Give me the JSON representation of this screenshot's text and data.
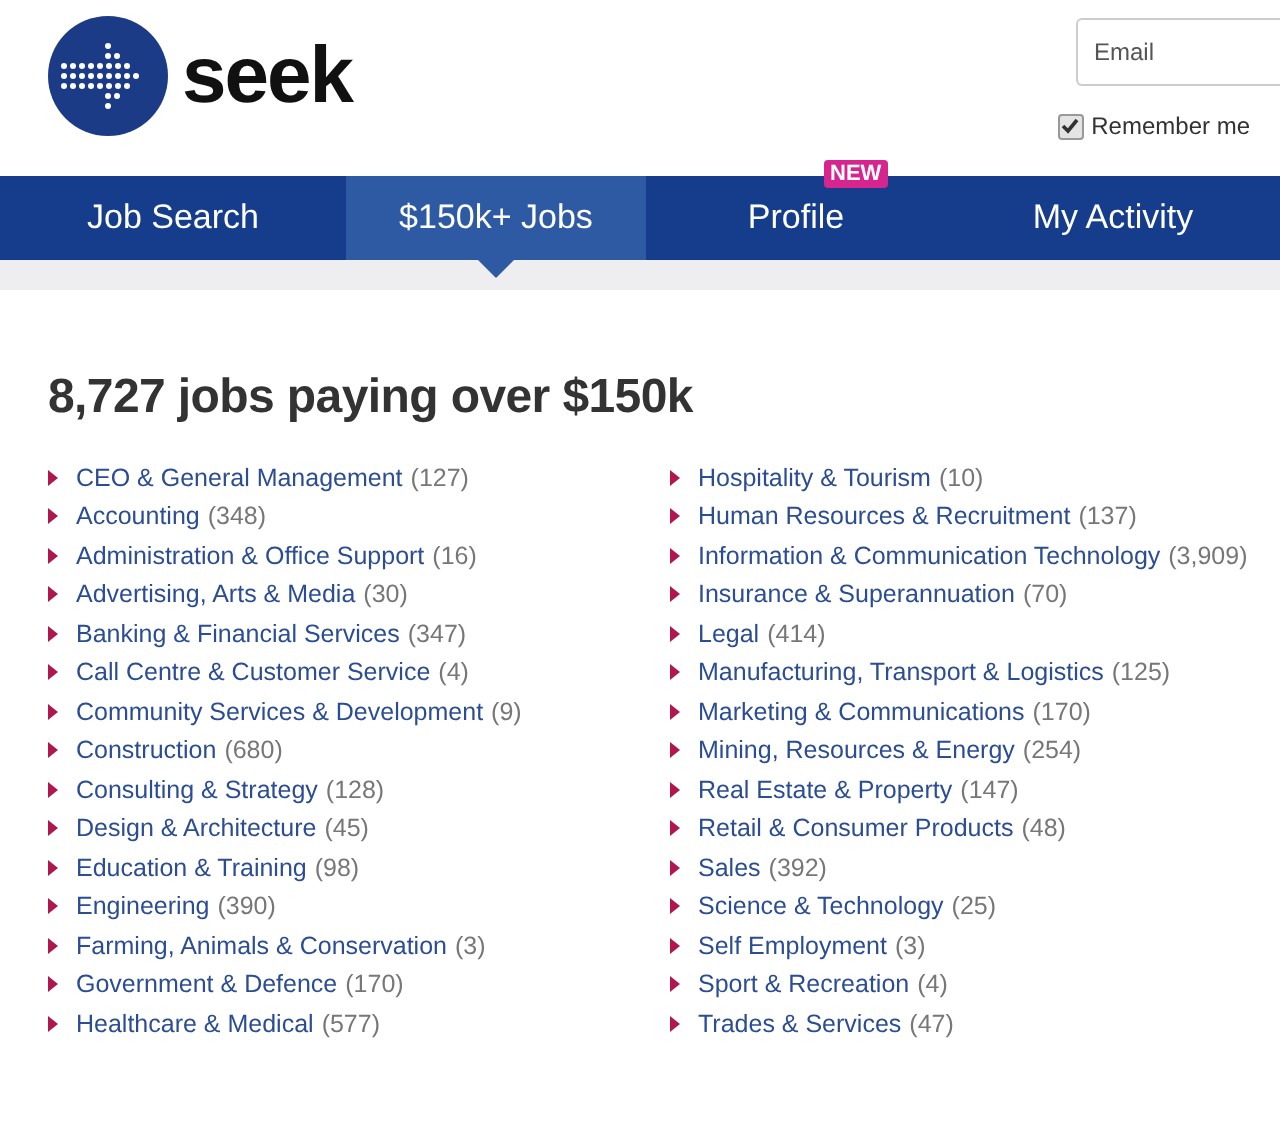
{
  "header": {
    "logo_text": "seek",
    "email": {
      "placeholder": "Email"
    },
    "remember_me": {
      "label": "Remember me",
      "checked": true
    }
  },
  "nav": {
    "tabs": [
      {
        "label": "Job Search",
        "selected": false
      },
      {
        "label": "$150k+ Jobs",
        "selected": true
      },
      {
        "label": "Profile",
        "selected": false,
        "badge": "NEW"
      },
      {
        "label": "My Activity",
        "selected": false
      }
    ]
  },
  "heading": "8,727 jobs paying over $150k",
  "categories": {
    "columns": [
      [
        {
          "name": "CEO & General Management",
          "count": "(127)"
        },
        {
          "name": "Accounting",
          "count": "(348)"
        },
        {
          "name": "Administration & Office Support",
          "count": "(16)"
        },
        {
          "name": "Advertising, Arts & Media",
          "count": "(30)"
        },
        {
          "name": "Banking & Financial Services",
          "count": "(347)"
        },
        {
          "name": "Call Centre & Customer Service",
          "count": "(4)"
        },
        {
          "name": "Community Services & Development",
          "count": "(9)"
        },
        {
          "name": "Construction",
          "count": "(680)"
        },
        {
          "name": "Consulting & Strategy",
          "count": "(128)"
        },
        {
          "name": "Design & Architecture",
          "count": "(45)"
        },
        {
          "name": "Education & Training",
          "count": "(98)"
        },
        {
          "name": "Engineering",
          "count": "(390)"
        },
        {
          "name": "Farming, Animals & Conservation",
          "count": "(3)"
        },
        {
          "name": "Government & Defence",
          "count": "(170)"
        },
        {
          "name": "Healthcare & Medical",
          "count": "(577)"
        }
      ],
      [
        {
          "name": "Hospitality & Tourism",
          "count": "(10)"
        },
        {
          "name": "Human Resources & Recruitment",
          "count": "(137)"
        },
        {
          "name": "Information & Communication Technology",
          "count": "(3,909)"
        },
        {
          "name": "Insurance & Superannuation",
          "count": "(70)"
        },
        {
          "name": "Legal",
          "count": "(414)"
        },
        {
          "name": "Manufacturing, Transport & Logistics",
          "count": "(125)"
        },
        {
          "name": "Marketing & Communications",
          "count": "(170)"
        },
        {
          "name": "Mining, Resources & Energy",
          "count": "(254)"
        },
        {
          "name": "Real Estate & Property",
          "count": "(147)"
        },
        {
          "name": "Retail & Consumer Products",
          "count": "(48)"
        },
        {
          "name": "Sales",
          "count": "(392)"
        },
        {
          "name": "Science & Technology",
          "count": "(25)"
        },
        {
          "name": "Self Employment",
          "count": "(3)"
        },
        {
          "name": "Sport & Recreation",
          "count": "(4)"
        },
        {
          "name": "Trades & Services",
          "count": "(47)"
        }
      ]
    ]
  }
}
